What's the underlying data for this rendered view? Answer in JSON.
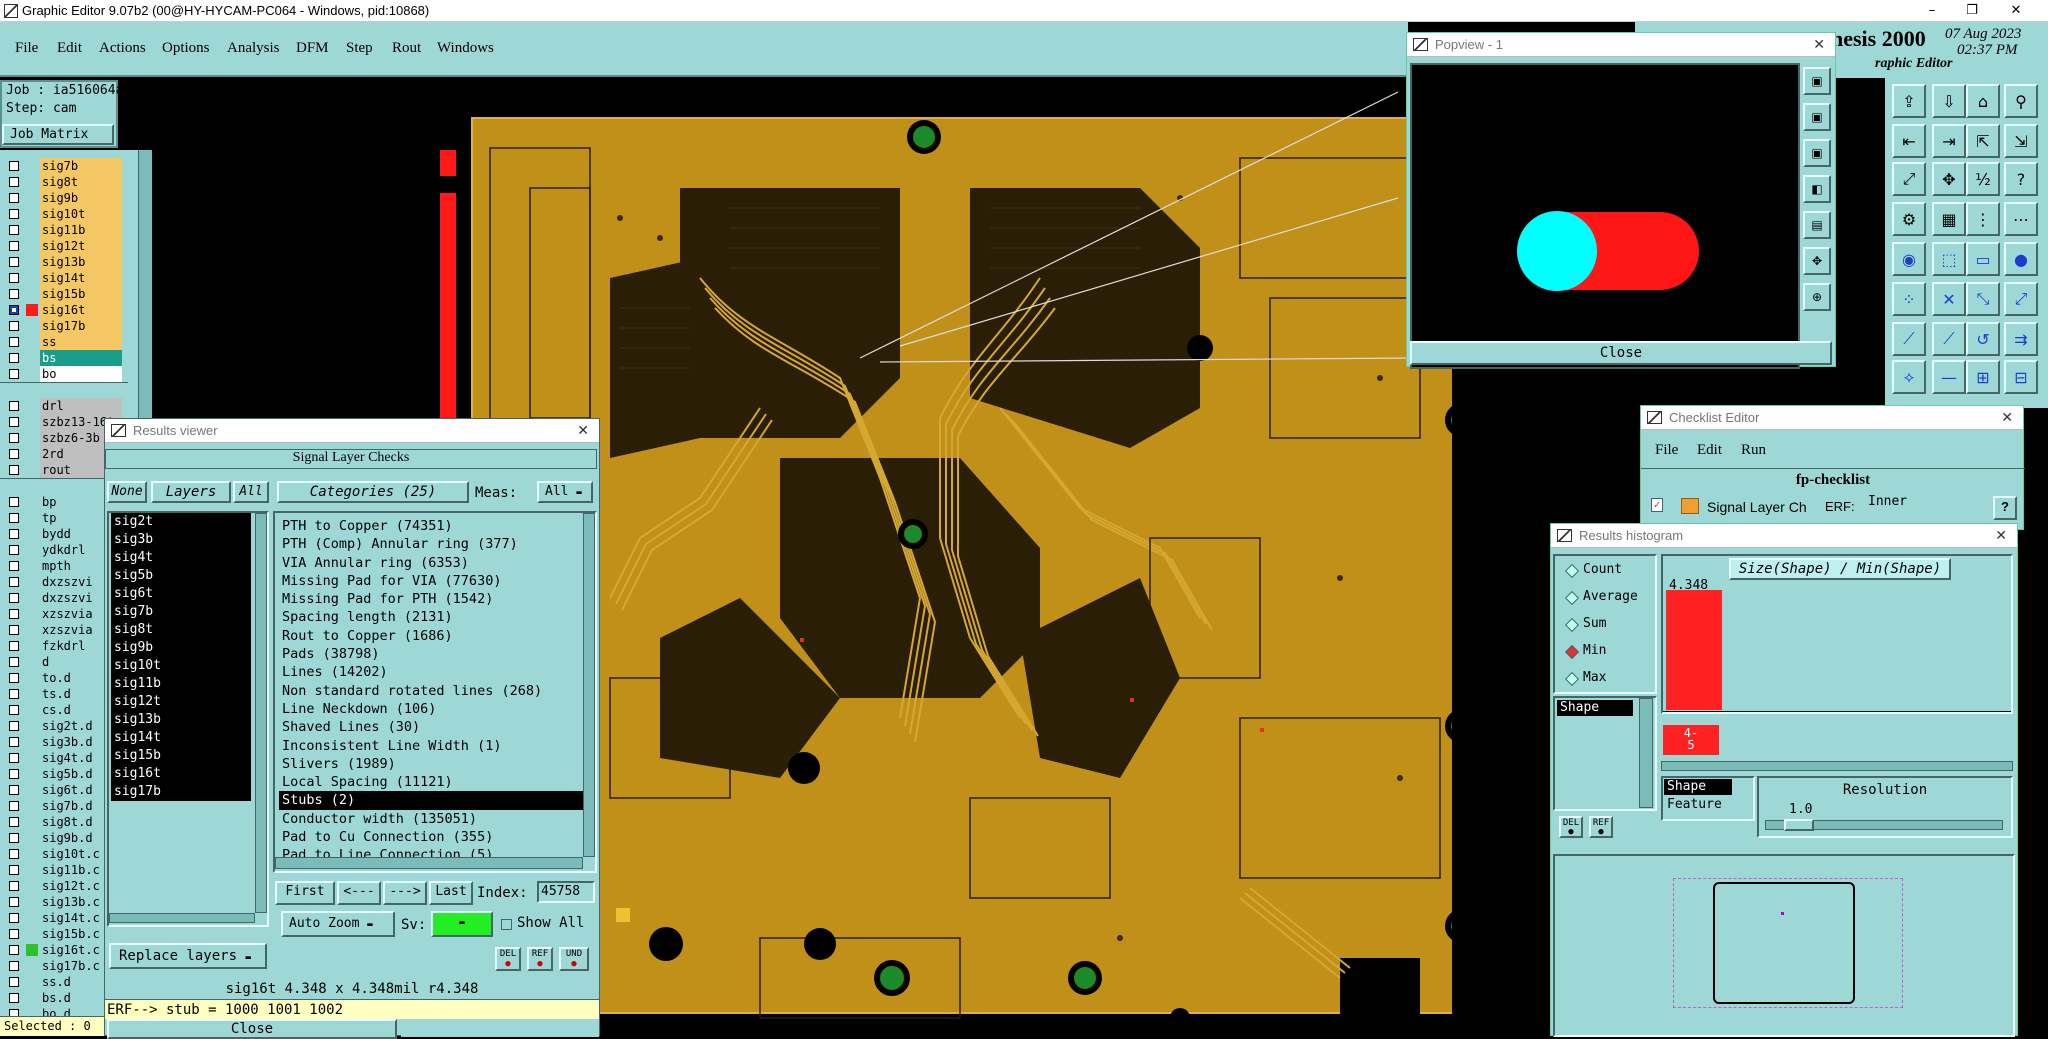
{
  "titlebar": {
    "title": "Graphic Editor 9.07b2 (00@HY-HYCAM-PC064 - Windows, pid:10868)",
    "min": "–",
    "max": "❐",
    "close": "✕"
  },
  "menu": [
    "File",
    "Edit",
    "Actions",
    "Options",
    "Analysis",
    "DFM",
    "Step",
    "Rout",
    "Windows"
  ],
  "brand": {
    "name": "nesis 2000",
    "sub": "raphic Editor",
    "date": "07 Aug 2023",
    "time": "02:37 PM"
  },
  "job": {
    "job": "Job : ia516064a0",
    "step": "Step: cam",
    "matrix_button": "Job Matrix ..."
  },
  "layers": [
    {
      "name": "sig7b",
      "color": "#f5c765"
    },
    {
      "name": "sig8t",
      "color": "#f5c765"
    },
    {
      "name": "sig9b",
      "color": "#f5c765"
    },
    {
      "name": "sig10t",
      "color": "#f5c765"
    },
    {
      "name": "sig11b",
      "color": "#f5c765"
    },
    {
      "name": "sig12t",
      "color": "#f5c765"
    },
    {
      "name": "sig13b",
      "color": "#f5c765"
    },
    {
      "name": "sig14t",
      "color": "#f5c765"
    },
    {
      "name": "sig15b",
      "color": "#f5c765"
    },
    {
      "name": "sig16t",
      "color": "#f5c765",
      "active": true
    },
    {
      "name": "sig17b",
      "color": "#f5c765"
    },
    {
      "name": "ss",
      "color": "#f5c765"
    },
    {
      "name": "bs",
      "color": "#1a9e8c"
    },
    {
      "name": "bo",
      "color": "#ffffff"
    },
    {
      "name": "",
      "color": ""
    },
    {
      "name": "drl",
      "color": "#bfbfbf"
    },
    {
      "name": "szbz13-16t",
      "color": "#bfbfbf"
    },
    {
      "name": "szbz6-3b",
      "color": "#bfbfbf"
    },
    {
      "name": "2rd",
      "color": "#bfbfbf"
    },
    {
      "name": "rout",
      "color": "#bfbfbf"
    },
    {
      "name": "",
      "color": ""
    },
    {
      "name": "bp",
      "color": "#9ed8d6"
    },
    {
      "name": "tp",
      "color": "#9ed8d6"
    },
    {
      "name": "bydd",
      "color": "#9ed8d6"
    },
    {
      "name": "ydkdrl",
      "color": "#9ed8d6"
    },
    {
      "name": "mpth",
      "color": "#9ed8d6"
    },
    {
      "name": "dxzszvi",
      "color": "#9ed8d6"
    },
    {
      "name": "dxzszvi",
      "color": "#9ed8d6"
    },
    {
      "name": "xzszvia",
      "color": "#9ed8d6"
    },
    {
      "name": "xzszvia",
      "color": "#9ed8d6"
    },
    {
      "name": "fzkdrl",
      "color": "#9ed8d6"
    },
    {
      "name": "d",
      "color": "#9ed8d6"
    },
    {
      "name": "to.d",
      "color": "#9ed8d6"
    },
    {
      "name": "ts.d",
      "color": "#9ed8d6"
    },
    {
      "name": "cs.d",
      "color": "#9ed8d6"
    },
    {
      "name": "sig2t.d",
      "color": "#9ed8d6"
    },
    {
      "name": "sig3b.d",
      "color": "#9ed8d6"
    },
    {
      "name": "sig4t.d",
      "color": "#9ed8d6"
    },
    {
      "name": "sig5b.d",
      "color": "#9ed8d6"
    },
    {
      "name": "sig6t.d",
      "color": "#9ed8d6"
    },
    {
      "name": "sig7b.d",
      "color": "#9ed8d6"
    },
    {
      "name": "sig8t.d",
      "color": "#9ed8d6"
    },
    {
      "name": "sig9b.d",
      "color": "#9ed8d6"
    },
    {
      "name": "sig10t.c",
      "color": "#9ed8d6"
    },
    {
      "name": "sig11b.c",
      "color": "#9ed8d6"
    },
    {
      "name": "sig12t.c",
      "color": "#9ed8d6"
    },
    {
      "name": "sig13b.c",
      "color": "#9ed8d6"
    },
    {
      "name": "sig14t.c",
      "color": "#9ed8d6"
    },
    {
      "name": "sig15b.c",
      "color": "#9ed8d6"
    },
    {
      "name": "sig16t.c",
      "color": "#9ed8d6",
      "green": true
    },
    {
      "name": "sig17b.c",
      "color": "#9ed8d6"
    },
    {
      "name": "ss.d",
      "color": "#9ed8d6"
    },
    {
      "name": "bs.d",
      "color": "#9ed8d6"
    },
    {
      "name": "bo.d",
      "color": "#9ed8d6"
    }
  ],
  "selected": "Selected : 0",
  "results_viewer": {
    "title": "Results viewer",
    "header": "Signal Layer Checks",
    "none": "None",
    "layers_btn": "Layers",
    "all": "All",
    "categories_btn": "Categories (25)",
    "meas": "Meas:",
    "meas_value": "All",
    "layers": [
      "sig2t",
      "sig3b",
      "sig4t",
      "sig5b",
      "sig6t",
      "sig7b",
      "sig8t",
      "sig9b",
      "sig10t",
      "sig11b",
      "sig12t",
      "sig13b",
      "sig14t",
      "sig15b",
      "sig16t",
      "sig17b"
    ],
    "categories": [
      "PTH to Copper (74351)",
      "PTH (Comp) Annular ring (377)",
      "VIA Annular ring (6353)",
      "Missing Pad for VIA (77630)",
      "Missing Pad for PTH (1542)",
      "Spacing length (2131)",
      "Rout to Copper (1686)",
      "Pads (38798)",
      "Lines (14202)",
      "Non standard rotated lines (268)",
      "Line Neckdown (106)",
      "Shaved Lines (30)",
      "Inconsistent Line Width (1)",
      "Slivers (1989)",
      "Local Spacing (11121)",
      "Stubs (2)",
      "Conductor width (135051)",
      "Pad to Cu Connection (355)",
      "Pad to Line Connection (5)"
    ],
    "selected_category": "Stubs (2)",
    "first": "First",
    "prev": "<---",
    "next": "--->",
    "last": "Last",
    "index_label": "Index:",
    "index_value": "45758",
    "auto_zoom": "Auto Zoom",
    "sv": "Sv:",
    "show_all": "Show All",
    "replace_layers": "Replace layers",
    "status": "sig16t 4.348 x 4.348mil  r4.348",
    "erf": "ERF--> stub = 1000 1001 1002",
    "close": "Close",
    "del": "DEL",
    "ref": "REF",
    "und": "UND"
  },
  "popview": {
    "title": "Popview - 1",
    "close": "Close"
  },
  "checklist": {
    "title": "Checklist Editor",
    "menu": [
      "File",
      "Edit",
      "Run"
    ],
    "name": "fp-checklist",
    "row_label": "Signal Layer Ch",
    "erf": "ERF:",
    "erf_value": "Inner",
    "help": "?"
  },
  "histogram": {
    "title": "Results histogram",
    "modes": [
      "Count",
      "Average",
      "Sum",
      "Min",
      "Max"
    ],
    "selected_mode": "Min",
    "shape_item": "Shape",
    "header_btn": "Size(Shape) / Min(Shape)",
    "bar_value": "4.348",
    "bar_fraction": 1.0,
    "bin_label": "4-\n5",
    "types": [
      "Shape",
      "Feature"
    ],
    "resolution_label": "Resolution",
    "resolution_value": "1.0",
    "del": "DEL",
    "ref": "REF",
    "colors": {
      "bar": "#ff2222"
    }
  }
}
